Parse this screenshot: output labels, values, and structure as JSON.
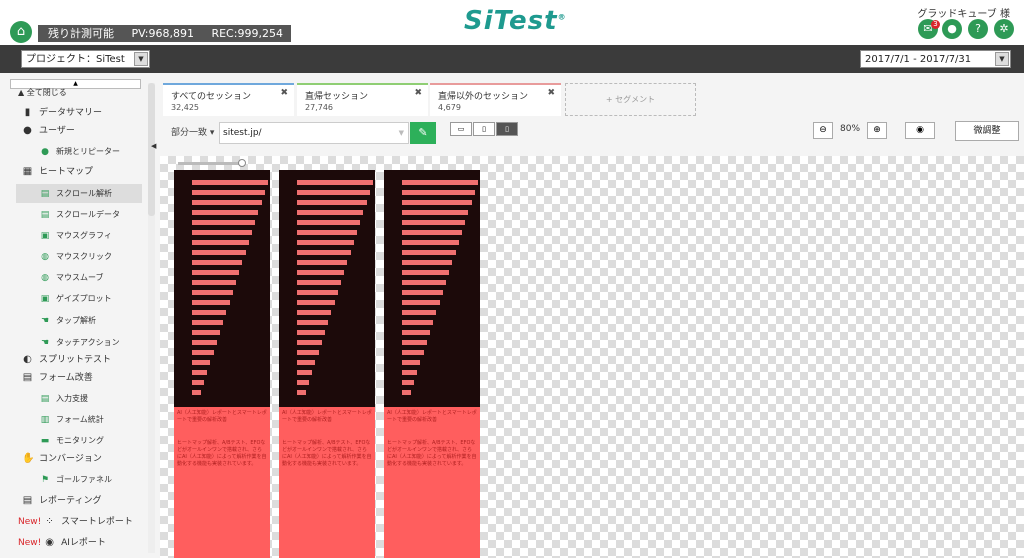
{
  "header": {
    "stats_label": "残り計測可能",
    "pv": "PV:968,891",
    "rec": "REC:999,254",
    "logo": "SiTest",
    "username": "グラッドキューブ 様",
    "notification_count": "3"
  },
  "projectbar": {
    "project": "プロジェクト：SiTest",
    "date_range": "2017/7/1 - 2017/7/31"
  },
  "sidebar": {
    "collapse_all": "全て閉じる",
    "items": [
      {
        "label": "データサマリー",
        "icon": "phone-icon"
      },
      {
        "label": "ユーザー",
        "icon": "user-icon"
      },
      {
        "label": "新規とリピーター",
        "icon": "new-repeater-icon"
      },
      {
        "label": "ヒートマップ",
        "icon": "heatmap-icon"
      },
      {
        "label": "スクロール解析",
        "icon": "scroll-analysis-icon"
      },
      {
        "label": "スクロールデータ",
        "icon": "scroll-data-icon"
      },
      {
        "label": "マウスグラフィ",
        "icon": "mouse-graphy-icon"
      },
      {
        "label": "マウスクリック",
        "icon": "mouse-click-icon"
      },
      {
        "label": "マウスムーブ",
        "icon": "mouse-move-icon"
      },
      {
        "label": "ゲイズプロット",
        "icon": "gaze-plot-icon"
      },
      {
        "label": "タップ解析",
        "icon": "tap-icon"
      },
      {
        "label": "タッチアクション",
        "icon": "touch-action-icon"
      },
      {
        "label": "スプリットテスト",
        "icon": "split-test-icon"
      },
      {
        "label": "フォーム改善",
        "icon": "form-icon"
      },
      {
        "label": "入力支援",
        "icon": "input-support-icon"
      },
      {
        "label": "フォーム統計",
        "icon": "form-stats-icon"
      },
      {
        "label": "モニタリング",
        "icon": "monitoring-icon"
      },
      {
        "label": "コンバージョン",
        "icon": "handshake-icon"
      },
      {
        "label": "ゴールファネル",
        "icon": "funnel-icon"
      },
      {
        "label": "レポーティング",
        "icon": "clipboard-icon"
      },
      {
        "label": "スマートレポート",
        "icon": "smart-report-icon"
      },
      {
        "label": "AIレポート",
        "icon": "ai-icon"
      }
    ],
    "new_label": "New!"
  },
  "segments": [
    {
      "title": "すべてのセッション",
      "value": "32,425",
      "color": "#6fa8dc"
    },
    {
      "title": "直帰セッション",
      "value": "27,746",
      "color": "#8fce74"
    },
    {
      "title": "直帰以外のセッション",
      "value": "4,679",
      "color": "#e89b9b"
    }
  ],
  "add_segment": "+ セグメント",
  "url_bar": {
    "match": "部分一致",
    "url": "sitest.jp/"
  },
  "zoom": {
    "level": "80%"
  },
  "fine_adjust": "微調整",
  "panel_texts": {
    "title": "AI（人工知能）レポートとスマートレポートで重要の解析改善",
    "body": "ヒートマップ解析、A/Bテスト、EFOなどがオールインワンで搭載され、さらにAI（人工知能）によって解析作業を自動化する機能も実装されています。"
  }
}
